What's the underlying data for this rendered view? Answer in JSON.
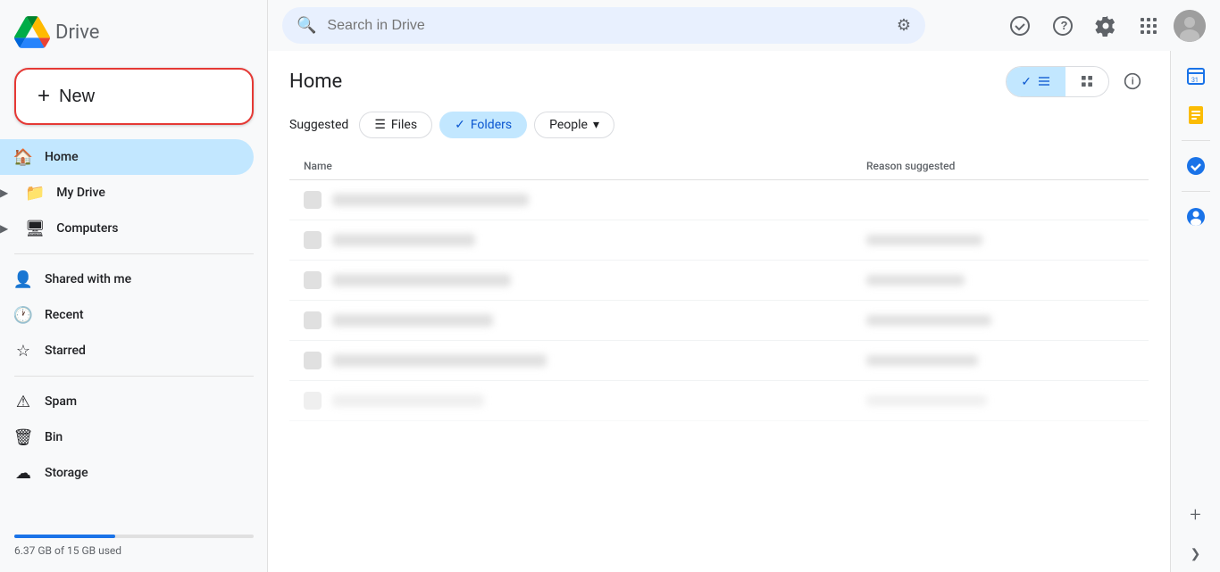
{
  "app": {
    "title": "Drive",
    "logo_alt": "Google Drive Logo"
  },
  "sidebar": {
    "new_button_label": "New",
    "nav_items": [
      {
        "id": "home",
        "label": "Home",
        "icon": "🏠",
        "active": true,
        "has_arrow": false
      },
      {
        "id": "my-drive",
        "label": "My Drive",
        "icon": "📁",
        "active": false,
        "has_arrow": true
      },
      {
        "id": "computers",
        "label": "Computers",
        "icon": "🖥",
        "active": false,
        "has_arrow": true
      }
    ],
    "nav_items_secondary": [
      {
        "id": "shared-with-me",
        "label": "Shared with me",
        "icon": "👤",
        "active": false
      },
      {
        "id": "recent",
        "label": "Recent",
        "icon": "🕐",
        "active": false
      },
      {
        "id": "starred",
        "label": "Starred",
        "icon": "☆",
        "active": false
      }
    ],
    "nav_items_tertiary": [
      {
        "id": "spam",
        "label": "Spam",
        "icon": "⚠",
        "active": false
      },
      {
        "id": "bin",
        "label": "Bin",
        "icon": "🗑",
        "active": false
      },
      {
        "id": "storage",
        "label": "Storage",
        "icon": "☁",
        "active": false
      }
    ],
    "storage": {
      "used_text": "6.37 GB of 15 GB used",
      "percent": 42
    }
  },
  "topbar": {
    "search_placeholder": "Search in Drive"
  },
  "main": {
    "page_title": "Home",
    "filter_label": "Suggested",
    "filters": [
      {
        "id": "files",
        "label": "Files",
        "icon": "☰",
        "active": false
      },
      {
        "id": "folders",
        "label": "Folders",
        "icon": "✓",
        "active": true
      },
      {
        "id": "people",
        "label": "People",
        "icon": "",
        "active": false,
        "has_arrow": true
      }
    ],
    "table_headers": [
      {
        "id": "name",
        "label": "Name"
      },
      {
        "id": "reason",
        "label": "Reason suggested"
      }
    ],
    "rows": [
      {
        "name_width": 220,
        "reason_width": 0
      },
      {
        "name_width": 160,
        "reason_width": 130
      },
      {
        "name_width": 200,
        "reason_width": 110
      },
      {
        "name_width": 180,
        "reason_width": 140
      },
      {
        "name_width": 240,
        "reason_width": 125
      },
      {
        "name_width": 170,
        "reason_width": 135
      }
    ]
  },
  "right_panel": {
    "icons": [
      {
        "id": "calendar",
        "symbol": "📅",
        "color": "#1a73e8"
      },
      {
        "id": "keep",
        "symbol": "💛",
        "color": "#fbbc04"
      },
      {
        "id": "tasks",
        "symbol": "✅",
        "color": "#0f9d58"
      },
      {
        "id": "contacts",
        "symbol": "👤",
        "color": "#1a73e8"
      }
    ],
    "add_label": "+"
  },
  "colors": {
    "active_bg": "#c2e7ff",
    "active_text": "#0b57d0",
    "accent_blue": "#1a73e8",
    "border": "#e0e0e0",
    "text_primary": "#202124",
    "text_secondary": "#5f6368",
    "new_button_border": "#e53935"
  }
}
